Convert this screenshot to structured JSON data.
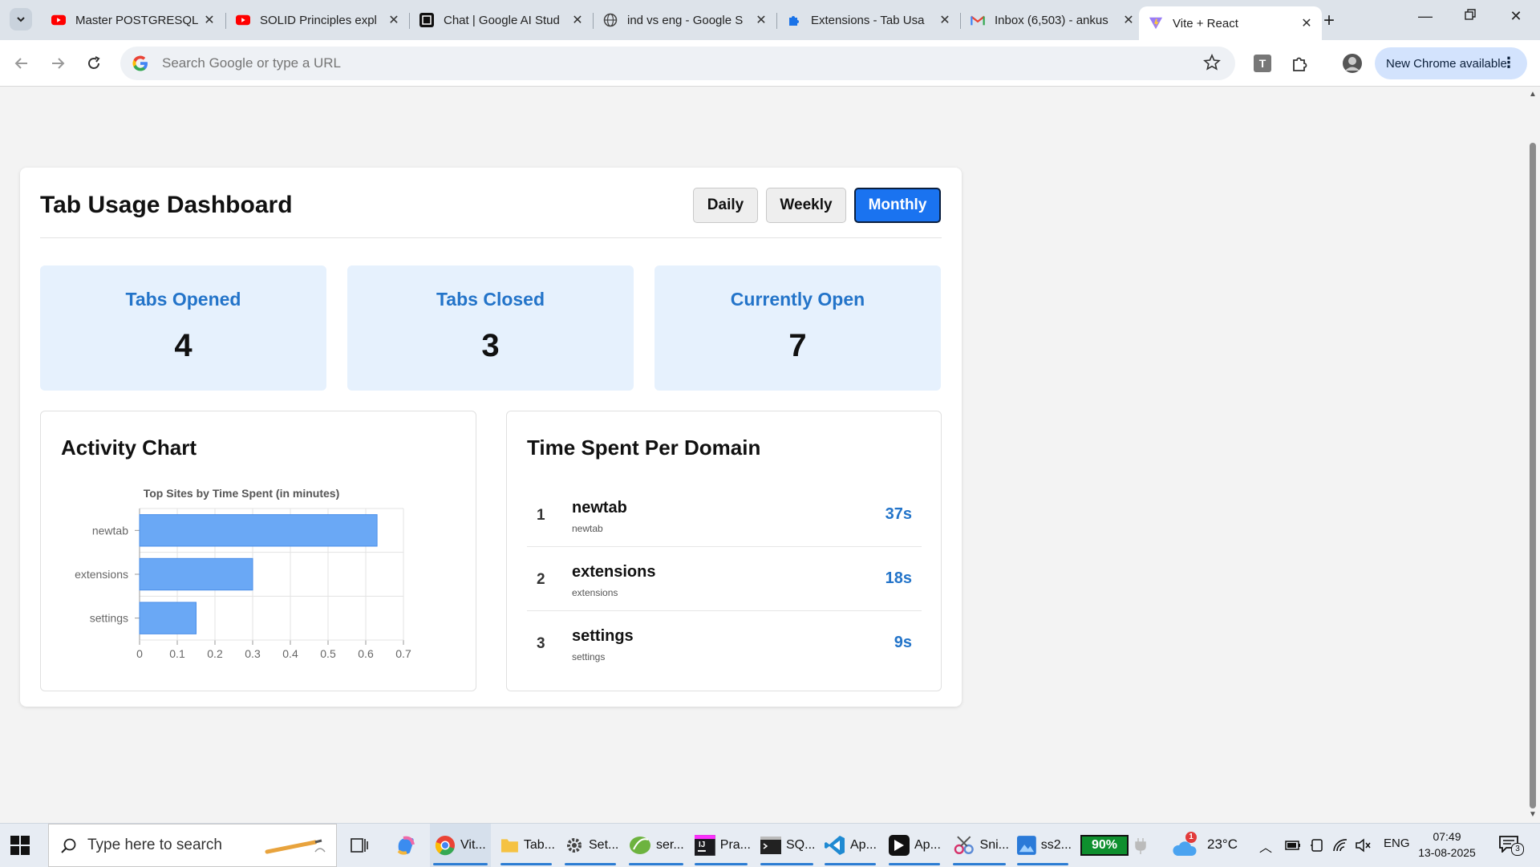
{
  "browser": {
    "tabs": [
      {
        "title": "Master POSTGRESQL",
        "icon": "youtube-icon"
      },
      {
        "title": "SOLID Principles expl",
        "icon": "youtube-icon"
      },
      {
        "title": "Chat | Google AI Stud",
        "icon": "ai-studio-icon"
      },
      {
        "title": "ind vs eng - Google S",
        "icon": "globe-icon"
      },
      {
        "title": "Extensions - Tab Usa",
        "icon": "puzzle-icon"
      },
      {
        "title": "Inbox (6,503) - ankus",
        "icon": "gmail-icon"
      },
      {
        "title": "Vite + React",
        "icon": "vite-icon",
        "active": true
      }
    ],
    "omnibox_placeholder": "Search Google or type a URL",
    "update_label": "New Chrome available",
    "extension_letter": "T"
  },
  "dashboard": {
    "title": "Tab Usage Dashboard",
    "periods": [
      "Daily",
      "Weekly",
      "Monthly"
    ],
    "active_period": "Monthly",
    "stats": [
      {
        "label": "Tabs Opened",
        "value": "4"
      },
      {
        "label": "Tabs Closed",
        "value": "3"
      },
      {
        "label": "Currently Open",
        "value": "7"
      }
    ],
    "activity_title": "Activity Chart",
    "domains_title": "Time Spent Per Domain",
    "domains": [
      {
        "rank": "1",
        "name": "newtab",
        "sub": "newtab",
        "time": "37s"
      },
      {
        "rank": "2",
        "name": "extensions",
        "sub": "extensions",
        "time": "18s"
      },
      {
        "rank": "3",
        "name": "settings",
        "sub": "settings",
        "time": "9s"
      }
    ]
  },
  "chart_data": {
    "type": "bar",
    "orientation": "horizontal",
    "title": "Top Sites by Time Spent (in minutes)",
    "categories": [
      "newtab",
      "extensions",
      "settings"
    ],
    "values": [
      0.63,
      0.3,
      0.15
    ],
    "xlim": [
      0,
      0.7
    ],
    "xticks": [
      "0",
      "0.1",
      "0.2",
      "0.3",
      "0.4",
      "0.5",
      "0.6",
      "0.7"
    ],
    "grid": true,
    "bar_color": "#6aa8f5"
  },
  "taskbar": {
    "search_placeholder": "Type here to search",
    "apps": [
      {
        "label": "Vit...",
        "icon": "chrome-icon"
      },
      {
        "label": "Tab...",
        "icon": "folder-icon"
      },
      {
        "label": "Set...",
        "icon": "settings-icon"
      },
      {
        "label": "ser...",
        "icon": "spring-icon"
      },
      {
        "label": "Pra...",
        "icon": "intellij-icon"
      },
      {
        "label": "SQ...",
        "icon": "terminal-icon"
      },
      {
        "label": "Ap...",
        "icon": "vscode-icon"
      },
      {
        "label": "Ap...",
        "icon": "cursor-icon"
      },
      {
        "label": "Sni...",
        "icon": "snipping-icon"
      },
      {
        "label": "ss2...",
        "icon": "photos-icon"
      }
    ],
    "battery": "90%",
    "weather_badge": "1",
    "temperature": "23°C",
    "language": "ENG",
    "time": "07:49",
    "date": "13-08-2025",
    "notifications": "3"
  }
}
